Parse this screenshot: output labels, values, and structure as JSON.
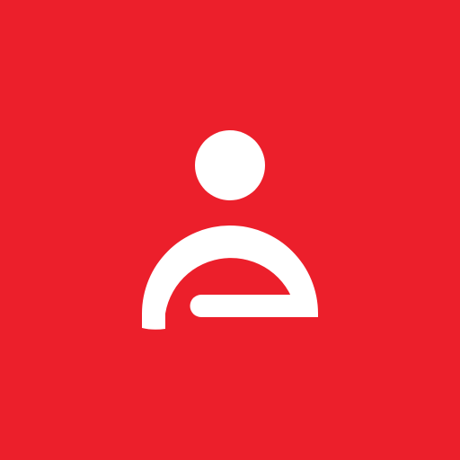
{
  "app_icon": {
    "icon_name": "person-logo-icon",
    "background_color": "#ec1f2b",
    "foreground_color": "#ffffff"
  }
}
